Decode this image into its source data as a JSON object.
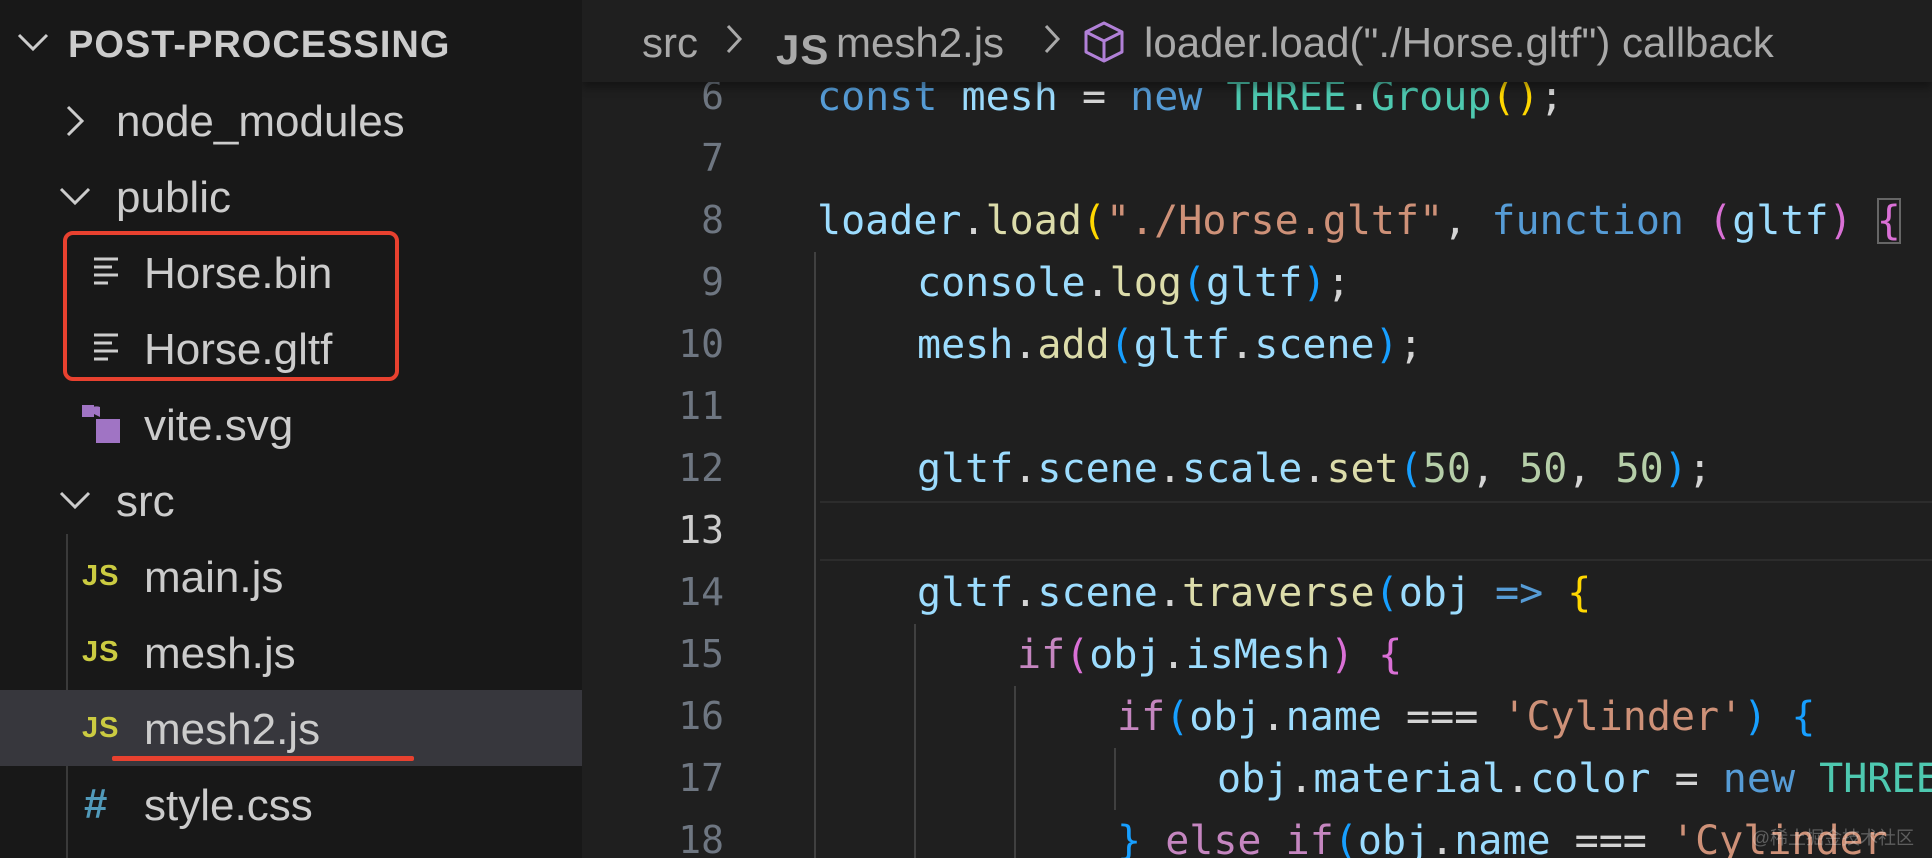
{
  "explorer": {
    "title": "POST-PROCESSING",
    "items": [
      {
        "label": "node_modules"
      },
      {
        "label": "public"
      },
      {
        "label": "Horse.bin"
      },
      {
        "label": "Horse.gltf"
      },
      {
        "label": "vite.svg"
      },
      {
        "label": "src"
      },
      {
        "label": "main.js",
        "icon_text": "JS"
      },
      {
        "label": "mesh.js",
        "icon_text": "JS"
      },
      {
        "label": "mesh2.js",
        "icon_text": "JS"
      },
      {
        "label": "style.css",
        "icon_text": "#"
      }
    ],
    "selected": "mesh2.js"
  },
  "breadcrumb": {
    "folder": "src",
    "file_icon": "JS",
    "file": "mesh2.js",
    "symbol": "loader.load(\"./Horse.gltf\") callback"
  },
  "editor": {
    "active_line": "13",
    "lines": [
      {
        "num": "6"
      },
      {
        "num": "7"
      },
      {
        "num": "8"
      },
      {
        "num": "9"
      },
      {
        "num": "10"
      },
      {
        "num": "11"
      },
      {
        "num": "12"
      },
      {
        "num": "13"
      },
      {
        "num": "14"
      },
      {
        "num": "15"
      },
      {
        "num": "16"
      },
      {
        "num": "17"
      },
      {
        "num": "18"
      }
    ],
    "tokens": {
      "l6": [
        "const",
        "mesh",
        "=",
        "new",
        "THREE",
        ".",
        "Group",
        "(",
        ")",
        ";"
      ],
      "l8": [
        "loader",
        ".",
        "load",
        "(",
        "\"./Horse.gltf\"",
        ",",
        "function",
        "(",
        "gltf",
        ")",
        "{"
      ],
      "l9": [
        "console",
        ".",
        "log",
        "(",
        "gltf",
        ")",
        ";"
      ],
      "l10": [
        "mesh",
        ".",
        "add",
        "(",
        "gltf",
        ".",
        "scene",
        ")",
        ";"
      ],
      "l12": [
        "gltf",
        ".",
        "scene",
        ".",
        "scale",
        ".",
        "set",
        "(",
        "50",
        ",",
        "50",
        ",",
        "50",
        ")",
        ";"
      ],
      "l14": [
        "gltf",
        ".",
        "scene",
        ".",
        "traverse",
        "(",
        "obj",
        "=>",
        "{"
      ],
      "l15": [
        "if",
        "(",
        "obj",
        ".",
        "isMesh",
        ")",
        "{"
      ],
      "l16": [
        "if",
        "(",
        "obj",
        ".",
        "name",
        "===",
        "'Cylinder'",
        ")",
        "{"
      ],
      "l17": [
        "obj",
        ".",
        "material",
        ".",
        "color",
        "=",
        "new",
        "THREE"
      ],
      "l18": [
        "}",
        "else",
        "if",
        "(",
        "obj",
        ".",
        "name",
        "===",
        "'Cylinder"
      ]
    }
  },
  "colors": {
    "annotation_red": "#e8412f",
    "js_icon": "#cbcb41",
    "css_icon": "#519aba",
    "svg_icon": "#a074c4",
    "symbol_icon": "#b180d7"
  },
  "watermark": "@稀土掘金技术社区"
}
